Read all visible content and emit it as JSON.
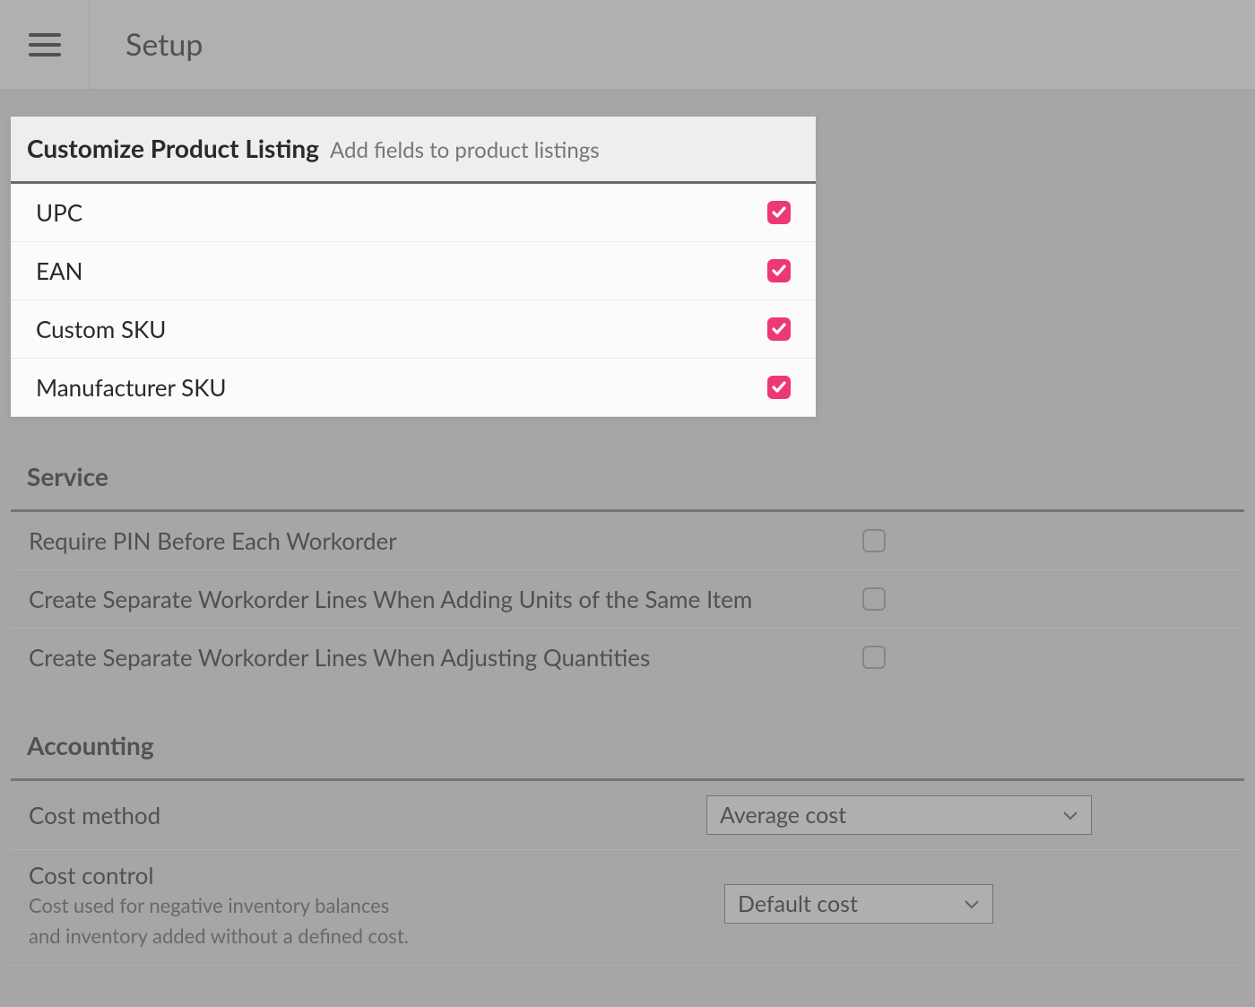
{
  "header": {
    "title": "Setup"
  },
  "product_listing": {
    "title": "Customize Product Listing",
    "subtitle": "Add fields to product listings",
    "items": [
      {
        "label": "UPC",
        "checked": true
      },
      {
        "label": "EAN",
        "checked": true
      },
      {
        "label": "Custom SKU",
        "checked": true
      },
      {
        "label": "Manufacturer SKU",
        "checked": true
      }
    ]
  },
  "service": {
    "title": "Service",
    "items": [
      {
        "label": "Require PIN Before Each Workorder",
        "checked": false
      },
      {
        "label": "Create Separate Workorder Lines When Adding Units of the Same Item",
        "checked": false
      },
      {
        "label": "Create Separate Workorder Lines When Adjusting Quantities",
        "checked": false
      }
    ]
  },
  "accounting": {
    "title": "Accounting",
    "cost_method": {
      "label": "Cost method",
      "value": "Average cost"
    },
    "cost_control": {
      "label": "Cost control",
      "sub1": "Cost used for negative inventory balances",
      "sub2": "and inventory added without a defined cost.",
      "value": "Default cost"
    }
  }
}
